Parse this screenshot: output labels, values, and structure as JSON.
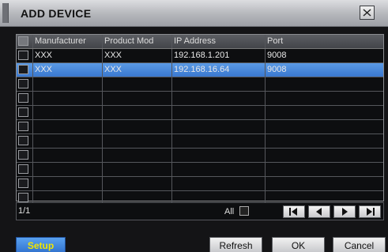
{
  "dialog": {
    "title": "ADD DEVICE"
  },
  "columns": [
    "Manufacturer",
    "Product Mod",
    "IP Address",
    "Port"
  ],
  "rows": [
    {
      "manufacturer": "XXX",
      "product_model": "XXX",
      "ip": "192.168.1.201",
      "port": "9008",
      "selected": false
    },
    {
      "manufacturer": "XXX",
      "product_model": "XXX",
      "ip": "192.168.16.64",
      "port": "9008",
      "selected": true
    }
  ],
  "footer": {
    "page_info": "1/1",
    "all_label": "All"
  },
  "buttons": {
    "setup": "Setup",
    "refresh": "Refresh",
    "ok": "OK",
    "cancel": "Cancel"
  },
  "colors": {
    "title_bar": "#b4b6bb",
    "selected_row": "#3a78cf",
    "setup_text": "#f2e600"
  },
  "icons": {
    "close": "close-icon",
    "first": "first-page-icon",
    "prev": "prev-page-icon",
    "next": "next-page-icon",
    "last": "last-page-icon"
  }
}
